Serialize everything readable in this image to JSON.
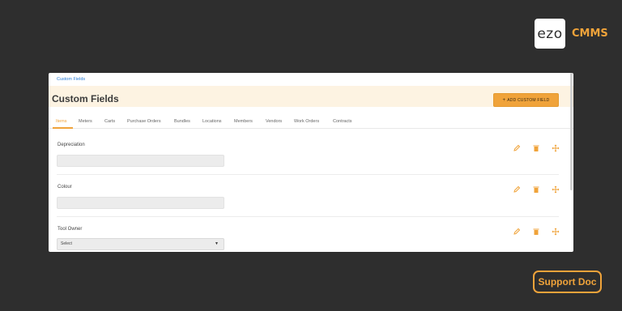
{
  "brand": {
    "logo_text": "ezo",
    "product": "CMMS"
  },
  "breadcrumb": "Custom Fields",
  "page_title": "Custom Fields",
  "add_button": {
    "icon": "+",
    "label": "ADD CUSTOM FIELD"
  },
  "tabs": [
    {
      "label": "Items",
      "active": true
    },
    {
      "label": "Meters"
    },
    {
      "label": "Carts"
    },
    {
      "label": "Purchase Orders"
    },
    {
      "label": "Bundles"
    },
    {
      "label": "Locations"
    },
    {
      "label": "Members"
    },
    {
      "label": "Vendors"
    },
    {
      "label": "Work Orders"
    },
    {
      "label": "Contracts"
    }
  ],
  "fields": [
    {
      "label": "Depreciation",
      "type": "text",
      "value": ""
    },
    {
      "label": "Colour",
      "type": "text",
      "value": ""
    },
    {
      "label": "Tool Owner",
      "type": "select",
      "value": "Select"
    }
  ],
  "actions": {
    "edit_icon": "pencil-icon",
    "delete_icon": "trash-icon",
    "move_icon": "move-icon"
  },
  "support_label": "Support Doc",
  "colors": {
    "accent": "#f0a33a",
    "background": "#2e2e2e",
    "header_band": "#fdf3e2",
    "link": "#2a7dd6"
  }
}
